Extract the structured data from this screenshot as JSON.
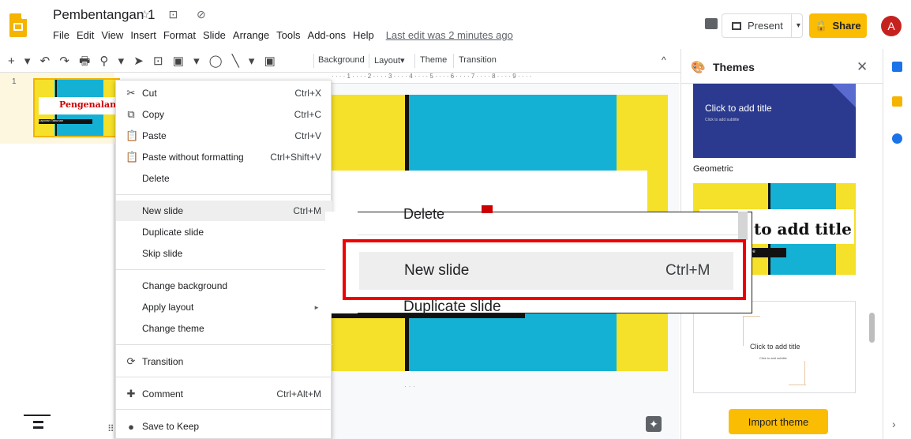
{
  "header": {
    "doc_title": "Pembentangan 1",
    "title_icons": "☆ ⊡ ⊘",
    "menu": [
      "File",
      "Edit",
      "View",
      "Insert",
      "Format",
      "Slide",
      "Arrange",
      "Tools",
      "Add-ons",
      "Help"
    ],
    "last_edit": "Last edit was 2 minutes ago",
    "present_label": "Present",
    "share_label": "Share",
    "avatar_letter": "A"
  },
  "toolbar": {
    "icons": "+ ▾ ↶ ↷ 🖶 ⚲ ▾ ➤ ⊡ ▣ ▾ ◯ ╲ ▾ ▣",
    "background_label": "Background",
    "layout_label": "Layout▾",
    "theme_label": "Theme",
    "transition_label": "Transition",
    "collapse": "^"
  },
  "ruler": "· · · · 1 · · · · 2 · · · · 3 · · · · 4 · · · · 5 · · · · 6 · · · · 7 · · · · 8 · · · · 9 · · · ·",
  "filmstrip": {
    "slide_number": "1",
    "thumb_title": "Pengenalan",
    "thumb_subtitle": "Laporan Tahunan"
  },
  "canvas": {
    "footer_dots": "· · ·"
  },
  "context_menu": {
    "items": [
      {
        "icon": "✂",
        "label": "Cut",
        "shortcut": "Ctrl+X"
      },
      {
        "icon": "⧉",
        "label": "Copy",
        "shortcut": "Ctrl+C"
      },
      {
        "icon": "📋",
        "label": "Paste",
        "shortcut": "Ctrl+V"
      },
      {
        "icon": "📋",
        "label": "Paste without formatting",
        "shortcut": "Ctrl+Shift+V"
      },
      {
        "icon": "",
        "label": "Delete",
        "shortcut": ""
      },
      {
        "icon": "",
        "label": "New slide",
        "shortcut": "Ctrl+M"
      },
      {
        "icon": "",
        "label": "Duplicate slide",
        "shortcut": ""
      },
      {
        "icon": "",
        "label": "Skip slide",
        "shortcut": ""
      },
      {
        "icon": "",
        "label": "Change background",
        "shortcut": ""
      },
      {
        "icon": "",
        "label": "Apply layout",
        "shortcut": "►"
      },
      {
        "icon": "",
        "label": "Change theme",
        "shortcut": ""
      },
      {
        "icon": "⟳",
        "label": "Transition",
        "shortcut": ""
      },
      {
        "icon": "✚",
        "label": "Comment",
        "shortcut": "Ctrl+Alt+M"
      },
      {
        "icon": "●",
        "label": "Save to Keep",
        "shortcut": ""
      }
    ]
  },
  "zoom_callout": {
    "delete_label": "Delete",
    "new_slide_label": "New slide",
    "new_slide_shortcut": "Ctrl+M",
    "duplicate_label": "Duplicate slide"
  },
  "themes_panel": {
    "title": "Themes",
    "close": "✕",
    "theme1_title": "Click to add title",
    "theme1_subtitle": "Click to add subtitle",
    "theme1_name": "Geometric",
    "theme2_title": "to add title",
    "theme2_subtitle": "le",
    "theme3_title": "Click to add title",
    "theme3_subtitle": "Click to add subtitle",
    "import_label": "Import theme"
  },
  "colors": {
    "accent": "#fbbc04",
    "slide_yellow": "#f5e02a",
    "slide_cyan": "#15b1d4",
    "highlight_red": "#ee0000"
  }
}
